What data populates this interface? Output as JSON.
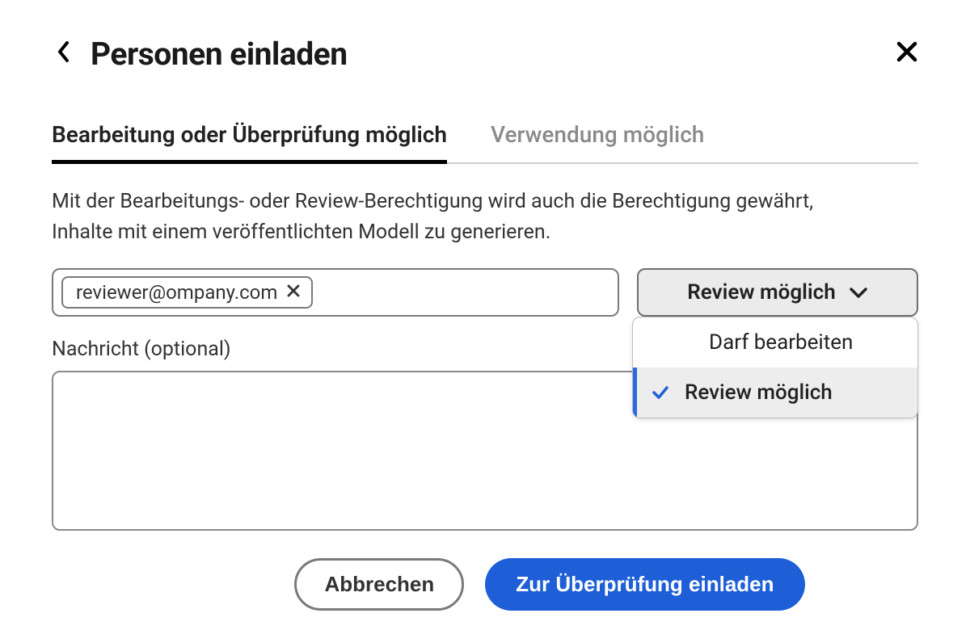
{
  "header": {
    "title": "Personen einladen"
  },
  "tabs": {
    "edit_review": "Bearbeitung oder Überprüfung möglich",
    "use": "Verwendung möglich"
  },
  "description": "Mit der Bearbeitungs- oder Review-Berechtigung wird auch die Berechtigung gewährt, Inhalte mit einem veröffentlichten Modell zu generieren.",
  "email_chip": {
    "value": "reviewer@ompany.com"
  },
  "permission": {
    "selected_label": "Review möglich",
    "options": {
      "edit": "Darf bearbeiten",
      "review": "Review möglich"
    }
  },
  "message": {
    "label": "Nachricht (optional)",
    "value": ""
  },
  "buttons": {
    "cancel": "Abbrechen",
    "invite": "Zur Überprüfung einladen"
  }
}
